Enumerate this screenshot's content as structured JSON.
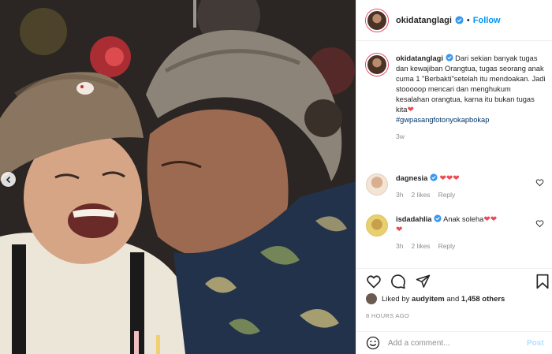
{
  "post": {
    "username": "okidatanglagi",
    "follow_label": "Follow",
    "dot": "•",
    "caption": {
      "username": "okidatanglagi",
      "text": "Dari sekian banyak tugas dan kewajiban Orangtua, tugas seorang anak cuma 1 \"Berbakti\"setelah itu mendoakan. Jadi stooooop mencari dan menghukum kesalahan orangtua, karna itu bukan tugas kita",
      "hashtag": "#gwpasangfotonyokapbokap",
      "age": "3w"
    },
    "comments": [
      {
        "username": "dagnesia",
        "text": "",
        "hearts": "❤❤❤",
        "age": "3h",
        "likes": "2 likes",
        "reply": "Reply"
      },
      {
        "username": "isdadahlia",
        "text": "Anak soleha",
        "hearts": "❤❤",
        "hearts2": "❤",
        "age": "3h",
        "likes": "2 likes",
        "reply": "Reply"
      }
    ],
    "liked_by_prefix": "Liked by",
    "liked_by_user": "audyitem",
    "liked_by_and": "and",
    "liked_by_count": "1,458 others",
    "timestamp": "8 HOURS AGO",
    "add_comment_placeholder": "Add a comment...",
    "post_label": "Post"
  },
  "colors": {
    "link": "#0095f6",
    "heart": "#ed4956",
    "muted": "#8e8e8e",
    "hashtag": "#00376b"
  },
  "icons": [
    "verified-badge-icon",
    "heart-icon",
    "comment-icon",
    "share-icon",
    "bookmark-icon",
    "emoji-icon",
    "chevron-left-icon"
  ]
}
